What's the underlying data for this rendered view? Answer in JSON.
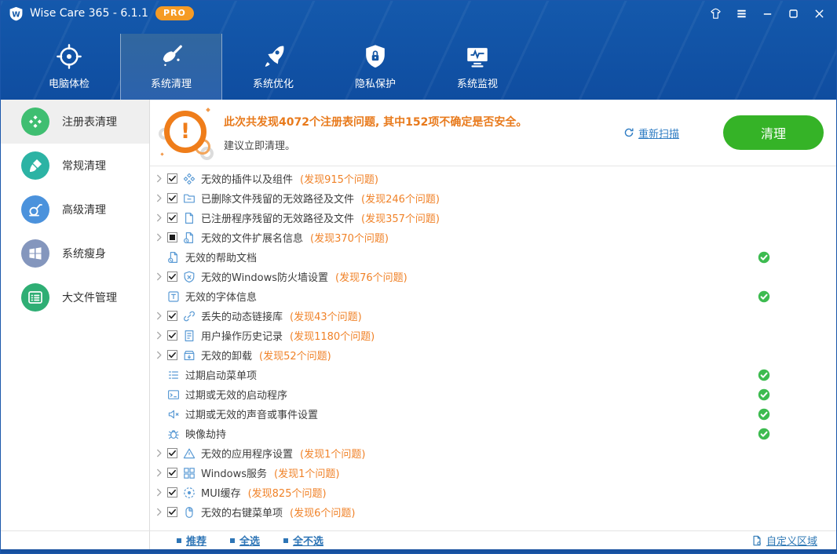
{
  "window": {
    "title": "Wise Care 365 - 6.1.1",
    "badge": "PRO"
  },
  "titlebar": {
    "icons": [
      {
        "name": "skin-button",
        "icon": "w-shirt"
      },
      {
        "name": "menu-button",
        "icon": "w-menu"
      },
      {
        "name": "minimize-button",
        "icon": "w-min"
      },
      {
        "name": "maximize-button",
        "icon": "w-max"
      },
      {
        "name": "close-button",
        "icon": "w-close"
      }
    ]
  },
  "nav": {
    "tabs": [
      {
        "name": "tab-pc-checkup",
        "icon": "target",
        "label": "电脑体检"
      },
      {
        "name": "tab-system-cleaner",
        "icon": "broom",
        "label": "系统清理",
        "active": true
      },
      {
        "name": "tab-system-tuneup",
        "icon": "rocket",
        "label": "系统优化"
      },
      {
        "name": "tab-privacy-protector",
        "icon": "shield",
        "label": "隐私保护"
      },
      {
        "name": "tab-system-monitor",
        "icon": "monitor",
        "label": "系统监视"
      }
    ]
  },
  "sidebar": {
    "items": [
      {
        "name": "sidebar-item-registry-cleaner",
        "icon": "registry",
        "color": "#3fbe71",
        "label": "注册表清理",
        "active": true
      },
      {
        "name": "sidebar-item-common-cleaner",
        "icon": "brush",
        "color": "#2cb3a4",
        "label": "常规清理"
      },
      {
        "name": "sidebar-item-advanced-cleaner",
        "icon": "vacuum",
        "color": "#4b92dc",
        "label": "高级清理"
      },
      {
        "name": "sidebar-item-system-slimming",
        "icon": "windows",
        "color": "#8496bd",
        "label": "系统瘦身"
      },
      {
        "name": "sidebar-item-big-files-manager",
        "icon": "files",
        "color": "#2fae74",
        "label": "大文件管理"
      }
    ]
  },
  "scan": {
    "summary": "此次共发现4072个注册表问题, 其中152项不确定是否安全。",
    "advice": "建议立即清理。",
    "rescan_label": "重新扫描",
    "clean_label": "清理"
  },
  "issues": {
    "rows": [
      {
        "expander": true,
        "checkbox": "checked",
        "icon": "components",
        "label": "无效的插件以及组件",
        "found": "(发现915个问题)"
      },
      {
        "expander": true,
        "checkbox": "checked",
        "icon": "folder",
        "label": "已删除文件残留的无效路径及文件",
        "found": "(发现246个问题)"
      },
      {
        "expander": true,
        "checkbox": "checked",
        "icon": "file",
        "label": "已注册程序残留的无效路径及文件",
        "found": "(发现357个问题)"
      },
      {
        "expander": true,
        "checkbox": "indeterminate",
        "icon": "file-ext",
        "label": "无效的文件扩展名信息",
        "found": "(发现370个问题)"
      },
      {
        "expander": false,
        "checkbox": "none",
        "icon": "help-doc",
        "label": "无效的帮助文档",
        "safe": true
      },
      {
        "expander": true,
        "checkbox": "checked",
        "icon": "firewall",
        "label": "无效的Windows防火墙设置",
        "found": "(发现76个问题)"
      },
      {
        "expander": false,
        "checkbox": "none",
        "icon": "font",
        "label": "无效的字体信息",
        "safe": true
      },
      {
        "expander": true,
        "checkbox": "checked",
        "icon": "link",
        "label": "丢失的动态链接库",
        "found": "(发现43个问题)"
      },
      {
        "expander": true,
        "checkbox": "checked",
        "icon": "history",
        "label": "用户操作历史记录",
        "found": "(发现1180个问题)"
      },
      {
        "expander": true,
        "checkbox": "checked",
        "icon": "uninstall",
        "label": "无效的卸载",
        "found": "(发现52个问题)"
      },
      {
        "expander": false,
        "checkbox": "none",
        "icon": "menu",
        "label": "过期启动菜单项",
        "safe": true
      },
      {
        "expander": false,
        "checkbox": "none",
        "icon": "startup",
        "label": "过期或无效的启动程序",
        "safe": true
      },
      {
        "expander": false,
        "checkbox": "none",
        "icon": "sound",
        "label": "过期或无效的声音或事件设置",
        "safe": true
      },
      {
        "expander": false,
        "checkbox": "none",
        "icon": "bug",
        "label": "映像劫持",
        "safe": true
      },
      {
        "expander": true,
        "checkbox": "checked",
        "icon": "warning",
        "label": "无效的应用程序设置",
        "found": "(发现1个问题)"
      },
      {
        "expander": true,
        "checkbox": "checked",
        "icon": "service",
        "label": "Windows服务",
        "found": "(发现1个问题)"
      },
      {
        "expander": true,
        "checkbox": "checked",
        "icon": "mui",
        "label": "MUI缓存",
        "found": "(发现825个问题)"
      },
      {
        "expander": true,
        "checkbox": "checked",
        "icon": "mouse",
        "label": "无效的右键菜单项",
        "found": "(发现6个问题)"
      }
    ]
  },
  "footer": {
    "links": [
      {
        "name": "recommend-link",
        "label": "推荐"
      },
      {
        "name": "select-all-link",
        "label": "全选"
      },
      {
        "name": "select-none-link",
        "label": "全不选"
      }
    ],
    "custom_label": "自定义区域"
  },
  "colors": {
    "header_blue": "#1459ac",
    "active_tab_blue": "#2b62ad",
    "accent_orange": "#ef7d1a",
    "pro_badge_orange": "#f59b25",
    "found_orange": "#f08228",
    "button_green": "#35b327",
    "safe_green": "#3dbb50",
    "link_blue": "#2e75b6",
    "row_icon_blue": "#5b9bd5"
  }
}
